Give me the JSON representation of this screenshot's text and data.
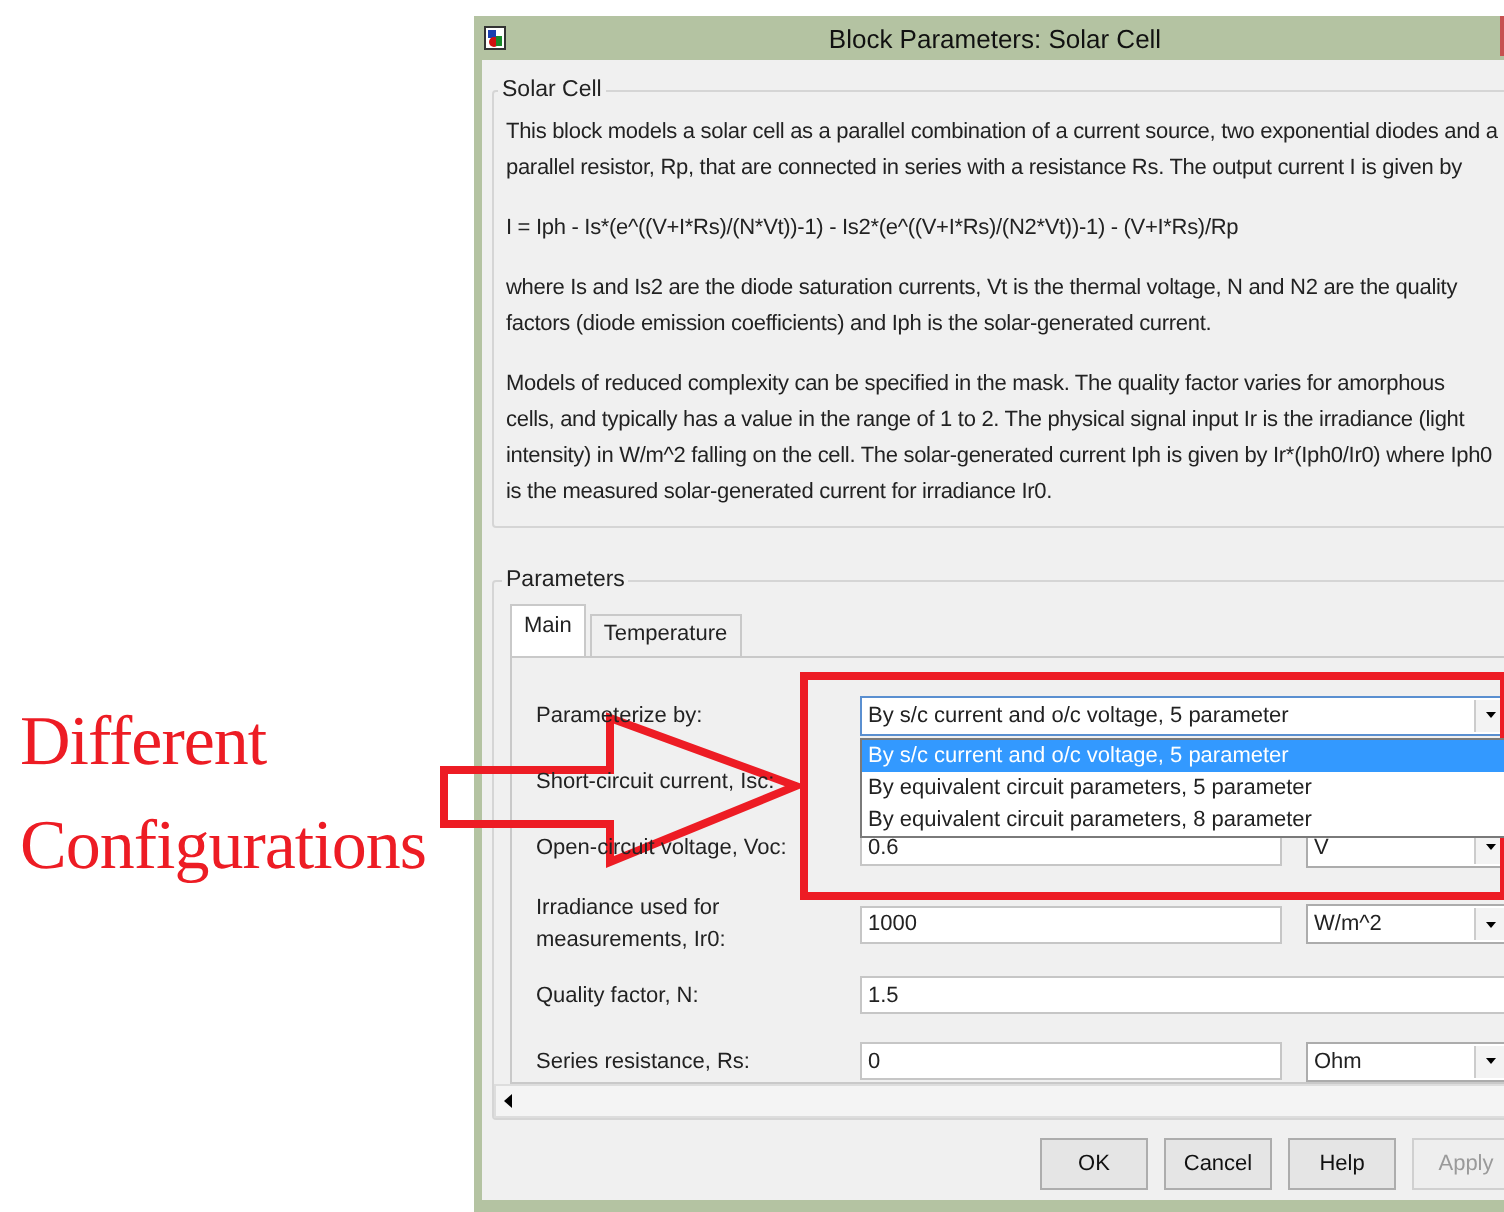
{
  "annotation": {
    "text": "Different Configurations"
  },
  "window": {
    "title": "Block Parameters: Solar Cell"
  },
  "description_group": {
    "title": "Solar Cell",
    "paragraphs": [
      "This block models a solar cell as a parallel combination of a current source, two exponential diodes and a parallel resistor, Rp, that are connected in series with a resistance Rs. The output current I is given by",
      "I = Iph - Is*(e^((V+I*Rs)/(N*Vt))-1) - Is2*(e^((V+I*Rs)/(N2*Vt))-1) - (V+I*Rs)/Rp",
      "where Is and Is2 are the diode saturation currents, Vt is the thermal voltage, N and N2 are the quality factors (diode emission coefficients) and Iph is the solar-generated current.",
      "Models of reduced complexity can be specified in the mask. The quality factor varies for amorphous cells, and typically has a value in the range of 1 to 2. The physical signal input Ir is the irradiance (light intensity) in W/m^2 falling on the cell. The solar-generated current Iph is given by Ir*(Iph0/Ir0) where Iph0 is the measured solar-generated current for irradiance Ir0."
    ]
  },
  "parameters_group": {
    "title": "Parameters",
    "tabs": [
      {
        "label": "Main",
        "selected": true
      },
      {
        "label": "Temperature",
        "selected": false
      }
    ],
    "rows": [
      {
        "kind": "dropdown",
        "label": "Parameterize by:",
        "value": "By s/c current and o/c voltage, 5 parameter",
        "expanded": true,
        "options": [
          {
            "label": "By s/c current and o/c voltage, 5 parameter",
            "selected": true
          },
          {
            "label": "By equivalent circuit parameters, 5 parameter",
            "selected": false
          },
          {
            "label": "By equivalent circuit parameters, 8 parameter",
            "selected": false
          }
        ]
      },
      {
        "kind": "label",
        "label": "Short-circuit current, Isc:"
      },
      {
        "kind": "value-unit",
        "label": "Open-circuit voltage, Voc:",
        "value": "0.6",
        "unit": "V"
      },
      {
        "kind": "value-unit",
        "label": "Irradiance used for measurements, Ir0:",
        "value": "1000",
        "unit": "W/m^2"
      },
      {
        "kind": "value",
        "label": "Quality factor, N:",
        "value": "1.5"
      },
      {
        "kind": "value-unit",
        "label": "Series resistance, Rs:",
        "value": "0",
        "unit": "Ohm"
      }
    ]
  },
  "buttons": [
    {
      "label": "OK",
      "disabled": false
    },
    {
      "label": "Cancel",
      "disabled": false
    },
    {
      "label": "Help",
      "disabled": false
    },
    {
      "label": "Apply",
      "disabled": true
    }
  ]
}
